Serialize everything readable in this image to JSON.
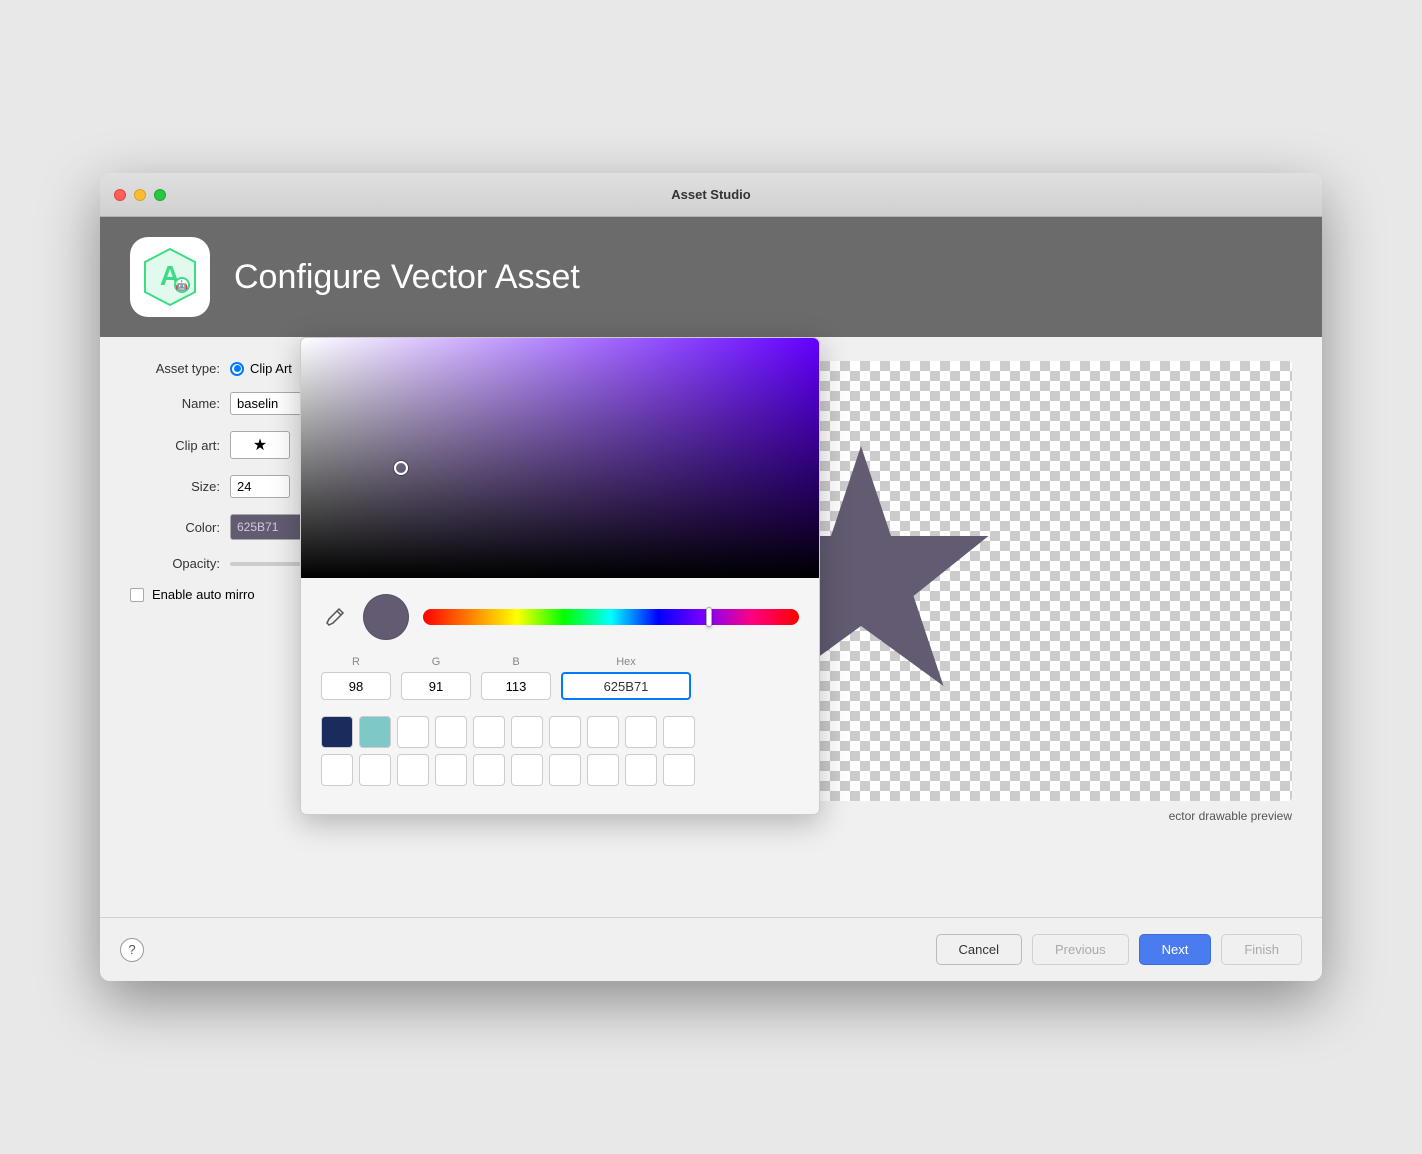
{
  "window": {
    "title": "Asset Studio"
  },
  "header": {
    "title": "Configure Vector Asset"
  },
  "form": {
    "asset_type_label": "Asset type:",
    "asset_type_value": "Clip Art",
    "name_label": "Name:",
    "name_value": "baselin",
    "clip_art_label": "Clip art:",
    "clip_art_icon": "★",
    "size_label": "Size:",
    "size_value": "24",
    "color_label": "Color:",
    "color_value": "625B71",
    "opacity_label": "Opacity:",
    "auto_mirror_label": "Enable auto mirro"
  },
  "color_picker": {
    "r_label": "R",
    "g_label": "G",
    "b_label": "B",
    "hex_label": "Hex",
    "r_value": "98",
    "g_value": "91",
    "b_value": "113",
    "hex_value": "625B71"
  },
  "preview": {
    "label": "ector drawable preview"
  },
  "footer": {
    "help_label": "?",
    "cancel_label": "Cancel",
    "previous_label": "Previous",
    "next_label": "Next",
    "finish_label": "Finish"
  }
}
